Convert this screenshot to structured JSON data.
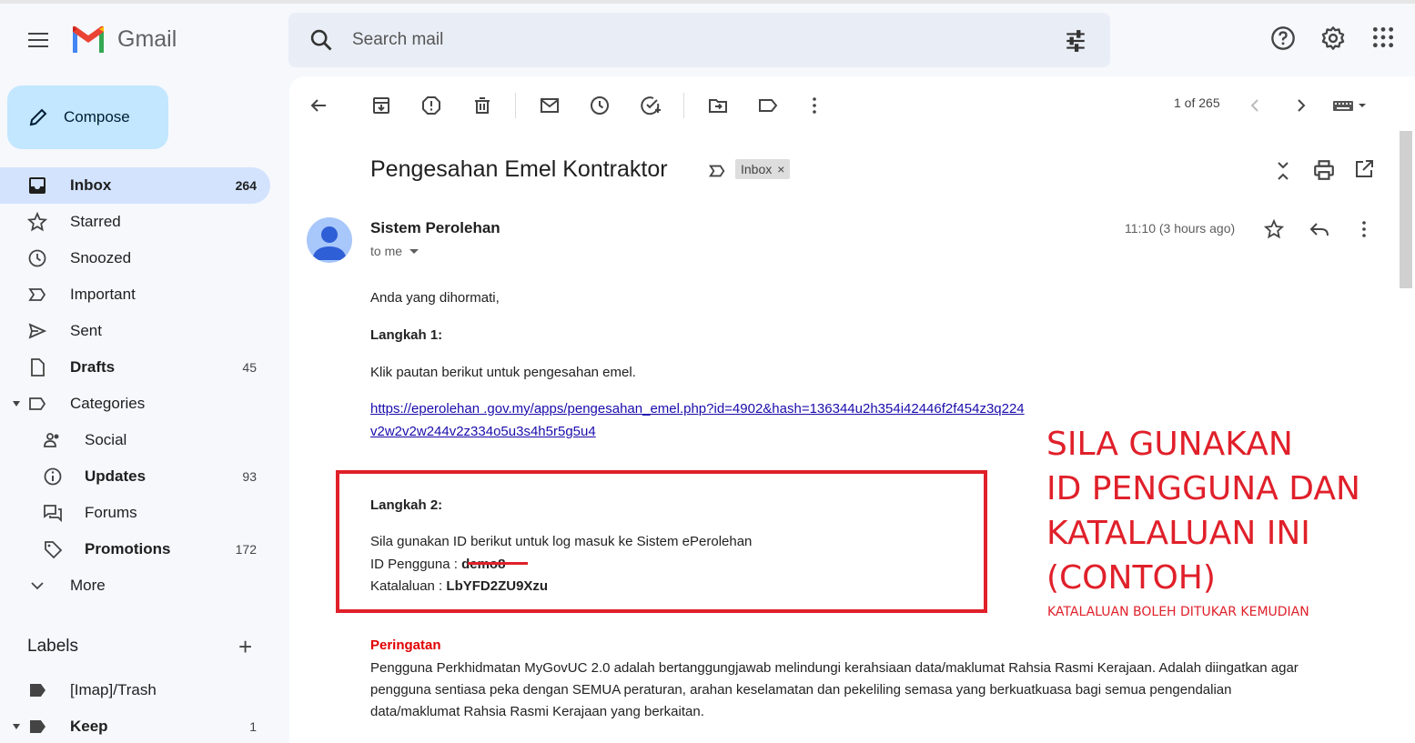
{
  "app": {
    "name": "Gmail"
  },
  "search": {
    "placeholder": "Search mail"
  },
  "compose": {
    "label": "Compose"
  },
  "nav": [
    {
      "label": "Inbox",
      "count": "264"
    },
    {
      "label": "Starred",
      "count": ""
    },
    {
      "label": "Snoozed",
      "count": ""
    },
    {
      "label": "Important",
      "count": ""
    },
    {
      "label": "Sent",
      "count": ""
    },
    {
      "label": "Drafts",
      "count": "45"
    },
    {
      "label": "Categories",
      "count": ""
    },
    {
      "label": "Social",
      "count": ""
    },
    {
      "label": "Updates",
      "count": "93"
    },
    {
      "label": "Forums",
      "count": ""
    },
    {
      "label": "Promotions",
      "count": "172"
    },
    {
      "label": "More",
      "count": ""
    }
  ],
  "labels": {
    "header": "Labels",
    "items": [
      {
        "label": "[Imap]/Trash",
        "count": ""
      },
      {
        "label": "Keep",
        "count": "1"
      }
    ]
  },
  "toolbar": {
    "pager": "1 of 265"
  },
  "email": {
    "subject": "Pengesahan Emel Kontraktor",
    "chip": "Inbox",
    "sender": "Sistem Perolehan",
    "to": "to me",
    "time": "11:10 (3 hours ago)",
    "greeting": "Anda yang dihormati,",
    "step1_title": "Langkah 1:",
    "step1_text": "Klik pautan berikut untuk pengesahan emel.",
    "link_line1": "https://eperolehan .gov.my/apps/pengesahan_emel.php?id=4902&hash=136344u2h354i42446f2f454z3q224",
    "link_line2": "v2w2v2w244v2z334o5u3s4h5r5g5u4",
    "step2_title": "Langkah 2:",
    "step2_text": "Sila gunakan ID berikut untuk log masuk ke Sistem ePerolehan",
    "id_label": "ID Pengguna :",
    "id_value": "demo8",
    "pw_label": "Katalaluan :",
    "pw_value": "LbYFD2ZU9Xzu",
    "warning_title": "Peringatan",
    "warning_line1": "Pengguna Perkhidmatan MyGovUC 2.0 adalah bertanggungjawab melindungi kerahsiaan data/maklumat Rahsia Rasmi Kerajaan. Adalah diingatkan agar",
    "warning_line2": "pengguna sentiasa peka dengan SEMUA peraturan, arahan keselamatan dan pekeliling semasa yang berkuatkuasa bagi semua pengendalian",
    "warning_line3": "data/maklumat Rahsia Rasmi Kerajaan yang berkaitan."
  },
  "annotation": {
    "line1": "SILA GUNAKAN",
    "line2": "ID PENGGUNA DAN",
    "line3": "KATALALUAN INI",
    "line4": "(CONTOH)",
    "sub": "KATALALUAN BOLEH DITUKAR KEMUDIAN",
    "color": "#e0202a"
  }
}
